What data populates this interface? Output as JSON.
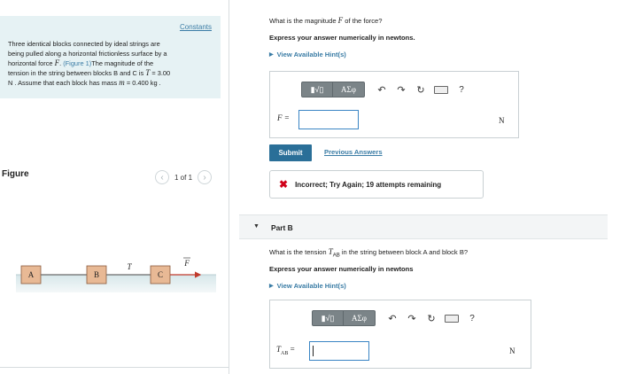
{
  "problem": {
    "constants_label": "Constants",
    "text_1": "Three identical blocks connected by ideal strings are",
    "text_2": "being pulled along a horizontal frictionless surface by a",
    "text_3a": "horizontal force ",
    "force_symbol": "F",
    "text_3b": ". ",
    "figure_link": "(Figure 1)",
    "text_3c": "The magnitude of the",
    "text_4a": "tension in the string between blocks B and C is ",
    "tension_symbol": "T",
    "text_4b": " = 3.00",
    "text_5a": "N . Assume that each block has mass ",
    "mass_symbol": "m",
    "text_5b": " = 0.400 kg ."
  },
  "figure": {
    "label": "Figure",
    "pager_text": "1 of 1",
    "prev_glyph": "‹",
    "next_glyph": "›",
    "blocks": [
      "A",
      "B",
      "C"
    ],
    "tension_label": "T",
    "force_label": "F"
  },
  "part_a": {
    "question_a": "What is the magnitude ",
    "question_sym": "F",
    "question_b": " of the force?",
    "instruction": "Express your answer numerically in newtons.",
    "hint_link": "View Available Hint(s)",
    "toolbar": {
      "sqrt_label": "▮√▯",
      "greek_label": "ΑΣφ",
      "undo_glyph": "↶",
      "redo_glyph": "↷",
      "reset_glyph": "↻",
      "help_glyph": "?"
    },
    "var_label": "F =",
    "input_value": "",
    "unit": "N",
    "submit_label": "Submit",
    "previous_answers": "Previous Answers",
    "feedback_icon": "✖",
    "feedback_text": "Incorrect; Try Again; 19 attempts remaining"
  },
  "part_b": {
    "title": "Part B",
    "collapse_glyph": "▼",
    "question_a": "What is the tension ",
    "question_sym": "T",
    "question_sub": "AB",
    "question_b": " in the string between block A and block B?",
    "instruction": "Express your answer numerically in newtons",
    "hint_link": "View Available Hint(s)",
    "toolbar": {
      "sqrt_label": "▮√▯",
      "greek_label": "ΑΣφ",
      "undo_glyph": "↶",
      "redo_glyph": "↷",
      "reset_glyph": "↻",
      "help_glyph": "?"
    },
    "var_label": "T",
    "var_sub": "AB",
    "var_eq": " =",
    "input_value": "",
    "unit": "N"
  },
  "colors": {
    "link": "#3a7ca5",
    "panel_bg": "#e6f2f4",
    "submit_bg": "#2a6f98",
    "error": "#d0021b",
    "input_border": "#3a85c4"
  }
}
